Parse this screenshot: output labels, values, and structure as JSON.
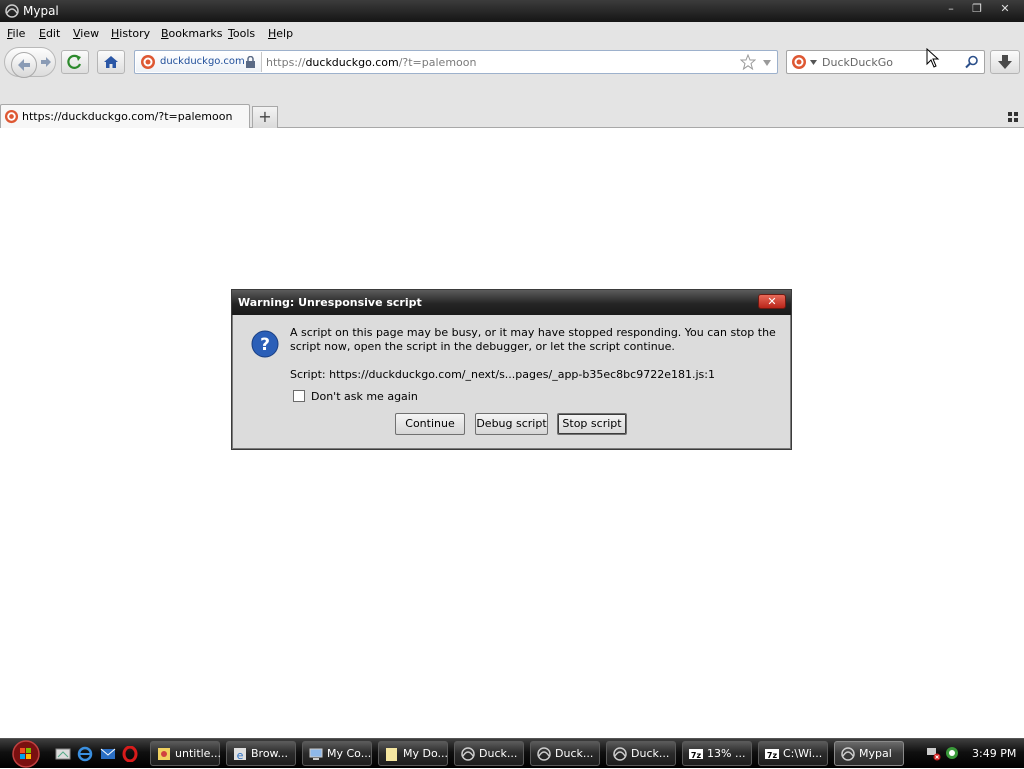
{
  "window": {
    "title": "Mypal",
    "minimize_label": "–",
    "restore_label": "❐",
    "close_label": "✕"
  },
  "menubar": {
    "items": [
      {
        "label_u": "F",
        "label_rest": "ile"
      },
      {
        "label_u": "E",
        "label_rest": "dit"
      },
      {
        "label_u": "V",
        "label_rest": "iew"
      },
      {
        "label_u": "H",
        "label_rest": "istory"
      },
      {
        "label_u": "B",
        "label_rest": "ookmarks"
      },
      {
        "label_u": "T",
        "label_rest": "ools"
      },
      {
        "label_u": "H",
        "label_rest": "elp"
      }
    ]
  },
  "navbar": {
    "identity_site": "duckduckgo.com",
    "url_scheme": "https://",
    "url_host": "duckduckgo.com",
    "url_rest": "/?t=palemoon",
    "search_placeholder": "DuckDuckGo"
  },
  "tabs": {
    "items": [
      {
        "label": "https://duckduckgo.com/?t=palemoon"
      }
    ],
    "new_tab_label": "+"
  },
  "dialog": {
    "title": "Warning: Unresponsive script",
    "close_label": "✕",
    "message": "A script on this page may be busy, or it may have stopped responding. You can stop the script now, open the script in the debugger, or let the script continue.",
    "script_line": "Script: https://duckduckgo.com/_next/s...pages/_app-b35ec8bc9722e181.js:1",
    "checkbox_label": "Don't ask me again",
    "buttons": {
      "continue": "Continue",
      "debug": "Debug script",
      "stop": "Stop script"
    }
  },
  "taskbar": {
    "tasks": [
      {
        "label": "untitle...",
        "icon": "paint-icon"
      },
      {
        "label": "Brow...",
        "icon": "browser-icon"
      },
      {
        "label": "My Co...",
        "icon": "computer-icon"
      },
      {
        "label": "My Do...",
        "icon": "folder-icon"
      },
      {
        "label": "Duck...",
        "icon": "mypal-icon"
      },
      {
        "label": "Duck...",
        "icon": "mypal-icon"
      },
      {
        "label": "Duck...",
        "icon": "mypal-icon"
      },
      {
        "label": "13% ...",
        "icon": "7zip-icon"
      },
      {
        "label": "C:\\Wi...",
        "icon": "7zip-icon"
      },
      {
        "label": "Mypal",
        "icon": "mypal-icon"
      }
    ],
    "clock": "3:49 PM"
  },
  "colors": {
    "accent": "#1f4e9a",
    "dialog_bg": "#dcdcdc",
    "close_red": "#c8392b"
  }
}
